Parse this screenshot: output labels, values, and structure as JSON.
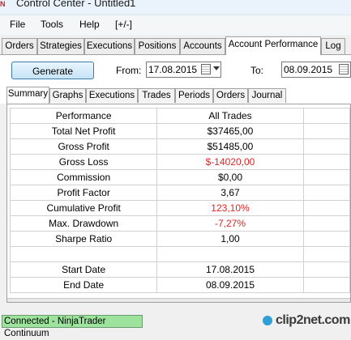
{
  "window": {
    "title": "Control Center - Untitled1"
  },
  "menu": [
    "File",
    "Tools",
    "Help",
    "[+/-]"
  ],
  "main_tabs": [
    "Orders",
    "Strategies",
    "Executions",
    "Positions",
    "Accounts",
    "Account Performance",
    "Log"
  ],
  "main_tab_active": "Account Performance",
  "controls": {
    "generate_label": "Generate",
    "from_label": "From:",
    "from_value": "17.08.2015",
    "to_label": "To:",
    "to_value": "08.09.2015"
  },
  "sub_tabs": [
    "Summary",
    "Graphs",
    "Executions",
    "Trades",
    "Periods",
    "Orders",
    "Journal"
  ],
  "sub_tab_active": "Summary",
  "table": {
    "headers": [
      "Performance",
      "All Trades"
    ],
    "rows": [
      {
        "label": "Total Net Profit",
        "value": "$37465,00",
        "negative": false
      },
      {
        "label": "Gross Profit",
        "value": "$51485,00",
        "negative": false
      },
      {
        "label": "Gross Loss",
        "value": "$-14020,00",
        "negative": true
      },
      {
        "label": "Commission",
        "value": "$0,00",
        "negative": false
      },
      {
        "label": "Profit Factor",
        "value": "3,67",
        "negative": false
      },
      {
        "label": "Cumulative Profit",
        "value": "123,10%",
        "negative": true
      },
      {
        "label": "Max. Drawdown",
        "value": "-7,27%",
        "negative": true
      },
      {
        "label": "Sharpe Ratio",
        "value": "1,00",
        "negative": false
      }
    ],
    "dates": [
      {
        "label": "Start Date",
        "value": "17.08.2015"
      },
      {
        "label": "End Date",
        "value": "08.09.2015"
      }
    ]
  },
  "status": {
    "connection": "Connected - NinjaTrader Continuum"
  },
  "watermark": "clip2net.com",
  "colors": {
    "negative": "#e02424",
    "connected_bg": "#9de39d",
    "accent": "#3d7bad"
  }
}
